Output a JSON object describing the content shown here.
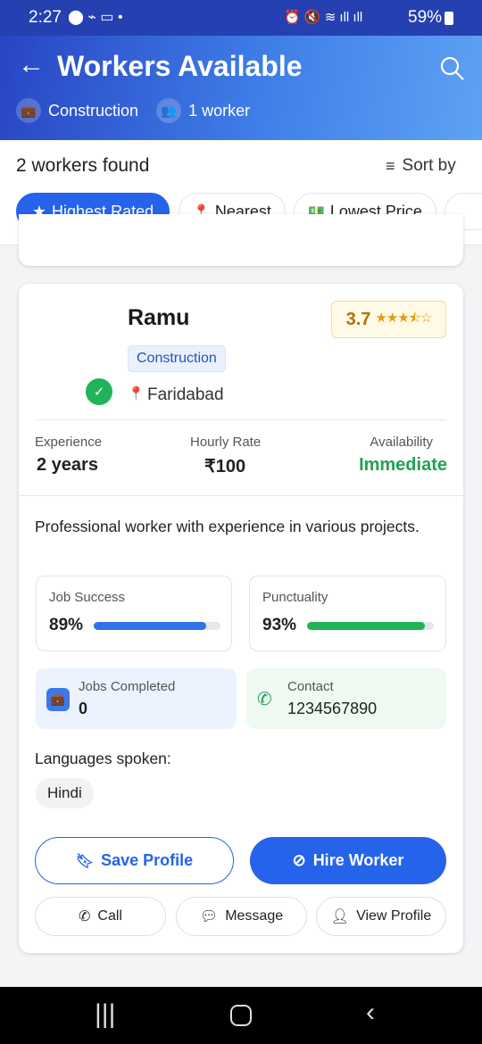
{
  "status": {
    "time": "2:27",
    "battery": "59%"
  },
  "header": {
    "title": "Workers Available",
    "category": "Construction",
    "workers": "1 worker"
  },
  "list": {
    "count": "2 workers found",
    "sort_label": "Sort by",
    "filters": [
      "Highest Rated",
      "Nearest",
      "Lowest Price"
    ]
  },
  "worker": {
    "name": "Ramu",
    "rating": "3.7",
    "stars": 3.7,
    "category": "Construction",
    "location": "Faridabad",
    "experience_label": "Experience",
    "experience": "2 years",
    "rate_label": "Hourly Rate",
    "rate": "₹100",
    "availability_label": "Availability",
    "availability": "Immediate",
    "description": "Professional worker with experience in various projects.",
    "job_success_label": "Job Success",
    "job_success": "89%",
    "job_success_value": 89,
    "punctuality_label": "Punctuality",
    "punctuality": "93%",
    "punctuality_value": 93,
    "jobs_completed_label": "Jobs Completed",
    "jobs_completed": "0",
    "contact_label": "Contact",
    "contact": "1234567890",
    "languages_label": "Languages spoken:",
    "languages": [
      "Hindi"
    ]
  },
  "actions": {
    "save": "Save Profile",
    "hire": "Hire Worker",
    "call": "Call",
    "message": "Message",
    "view": "View Profile"
  },
  "colors": {
    "primary": "#2563eb",
    "green": "#22a055"
  }
}
